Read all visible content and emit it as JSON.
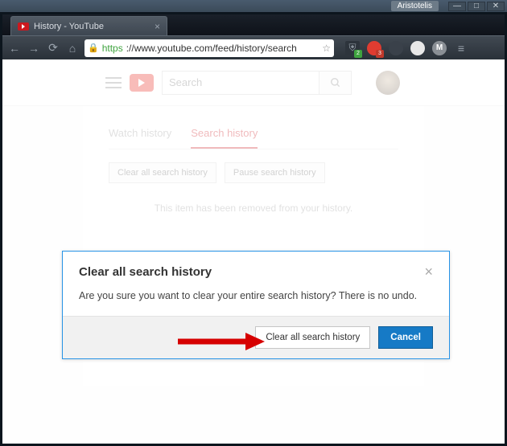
{
  "windowChrome": {
    "userLabel": "Aristotelis"
  },
  "tab": {
    "title": "History - YouTube"
  },
  "addressBar": {
    "scheme": "https",
    "rest": "://www.youtube.com/feed/history/search"
  },
  "extensions": {
    "greenBadge": "2",
    "redBadge": "3"
  },
  "ytHeader": {
    "searchPlaceholder": "Search"
  },
  "historyTabs": {
    "watch": "Watch history",
    "search": "Search history"
  },
  "historyActions": {
    "clearAll": "Clear all search history",
    "pause": "Pause search history"
  },
  "removedMessage": "This item has been removed from your history.",
  "modal": {
    "title": "Clear all search history",
    "body": "Are you sure you want to clear your entire search history? There is no undo.",
    "confirm": "Clear all search history",
    "cancel": "Cancel"
  }
}
